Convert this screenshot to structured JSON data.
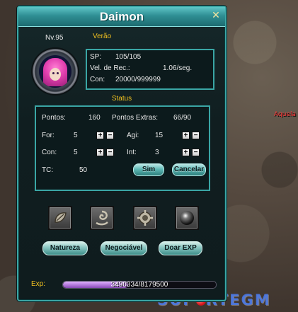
{
  "window": {
    "title": "Daimon",
    "close_icon": "close-icon"
  },
  "profile": {
    "level": "Nv.95",
    "season": "Verão"
  },
  "resources": [
    {
      "label": "SP:",
      "value": "105/105"
    },
    {
      "label": "Vel. de Rec.:",
      "value": "1.06/seg."
    },
    {
      "label": "Con:",
      "value": "20000/999999"
    }
  ],
  "status": {
    "header": "Status",
    "points_label": "Pontos:",
    "points_value": "160",
    "extra_label": "Pontos Extras:",
    "extra_value": "66/90",
    "str_label": "For:",
    "str_value": "5",
    "agi_label": "Agi:",
    "agi_value": "15",
    "con_label": "Con:",
    "con_value": "5",
    "int_label": "Int:",
    "int_value": "3",
    "tc_label": "TC:",
    "tc_value": "50",
    "plus": "+",
    "minus": "−",
    "confirm_label": "Sim",
    "cancel_label": "Cancelar"
  },
  "skills": [
    {
      "icon": "leaf-emblem-icon"
    },
    {
      "icon": "swirl-emblem-icon"
    },
    {
      "icon": "gear-emblem-icon"
    },
    {
      "icon": "orb-icon"
    }
  ],
  "actions": {
    "nature_label": "Natureza",
    "trade_label": "Negociável",
    "exp_label": "Doar EXP"
  },
  "experience": {
    "label": "Exp:",
    "text": "3490334/8179500",
    "progress": 0.4267
  },
  "scene": {
    "npc_name": "Aquela",
    "watermark": "SUPORTEGM"
  },
  "colors": {
    "accent": "#3aa6a5",
    "label_gold": "#f0c020",
    "npc_red": "#ff3a3a",
    "exp_fill": "#b57ae0"
  }
}
